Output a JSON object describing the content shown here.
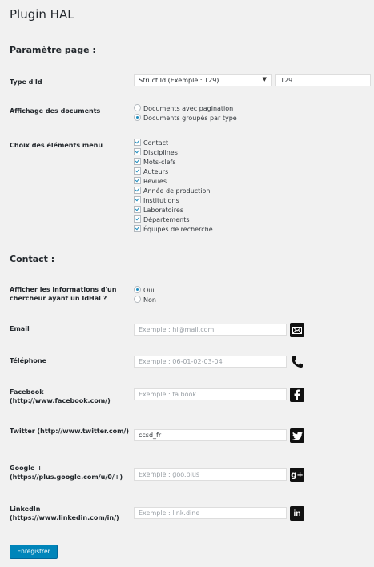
{
  "plugin_title": "Plugin HAL",
  "sections": {
    "page_params": "Paramètre page :",
    "contact": "Contact :"
  },
  "page": {
    "type_id": {
      "label": "Type d'Id",
      "select_value": "Struct Id (Exemple : 129)",
      "value": "129"
    },
    "affichage": {
      "label": "Affichage des documents",
      "options": [
        "Documents avec pagination",
        "Documents groupés par type"
      ],
      "selected": 1
    },
    "menu": {
      "label": "Choix des éléments menu",
      "items": [
        "Contact",
        "Disciplines",
        "Mots-clefs",
        "Auteurs",
        "Revues",
        "Année de production",
        "Institutions",
        "Laboratoires",
        "Départements",
        "Équipes de recherche"
      ]
    }
  },
  "contact": {
    "idhal": {
      "label": "Afficher les informations d'un chercheur ayant un IdHal ?",
      "options": [
        "Oui",
        "Non"
      ],
      "selected": 0
    },
    "email": {
      "label": "Email",
      "placeholder": "Exemple : hi@mail.com",
      "icon": "email-icon"
    },
    "phone": {
      "label": "Téléphone",
      "placeholder": "Exemple : 06-01-02-03-04",
      "icon": "phone-icon"
    },
    "facebook": {
      "label": "Facebook (http://www.facebook.com/)",
      "placeholder": "Exemple : fa.book",
      "icon": "facebook-icon"
    },
    "twitter": {
      "label": "Twitter (http://www.twitter.com/)",
      "value": "ccsd_fr",
      "icon": "twitter-icon"
    },
    "google": {
      "label": "Google + (https://plus.google.com/u/0/+)",
      "placeholder": "Exemple : goo.plus",
      "icon": "googleplus-icon"
    },
    "linkedin": {
      "label": "LinkedIn (https://www.linkedin.com/in/)",
      "placeholder": "Exemple : link.dine",
      "icon": "linkedin-icon"
    }
  },
  "save_label": "Enregistrer",
  "colors": {
    "accent": "#0085ba",
    "radio_dot": "#1e8cbe"
  }
}
